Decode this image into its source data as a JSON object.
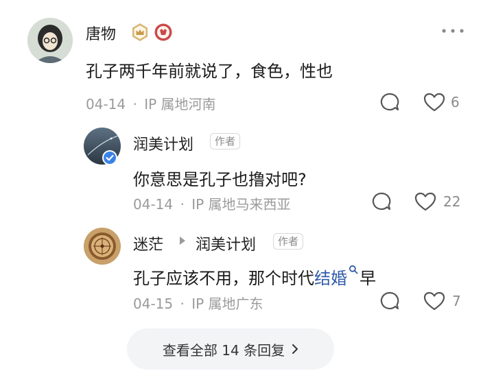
{
  "comments": [
    {
      "username": "唐物",
      "content": "孔子两千年前就说了，食色，性也",
      "date": "04-14",
      "ip": "IP 属地河南",
      "likes": "6"
    }
  ],
  "replies": [
    {
      "username": "润美计划",
      "author_tag": "作者",
      "content": "你意思是孔子也撸对吧?",
      "date": "04-14",
      "ip": "IP 属地马来西亚",
      "likes": "22"
    },
    {
      "username": "迷茫",
      "reply_to": "润美计划",
      "author_tag": "作者",
      "content_prefix": "孔子应该不用，那个时代",
      "content_link": "结婚",
      "content_suffix": "早",
      "date": "04-15",
      "ip": "IP 属地广东",
      "likes": "7"
    }
  ],
  "separator": "·",
  "view_all": "查看全部 14 条回复",
  "colors": {
    "link": "#2f5aa8",
    "meta": "#9a9a9a",
    "button_bg": "#f3f4f6"
  }
}
